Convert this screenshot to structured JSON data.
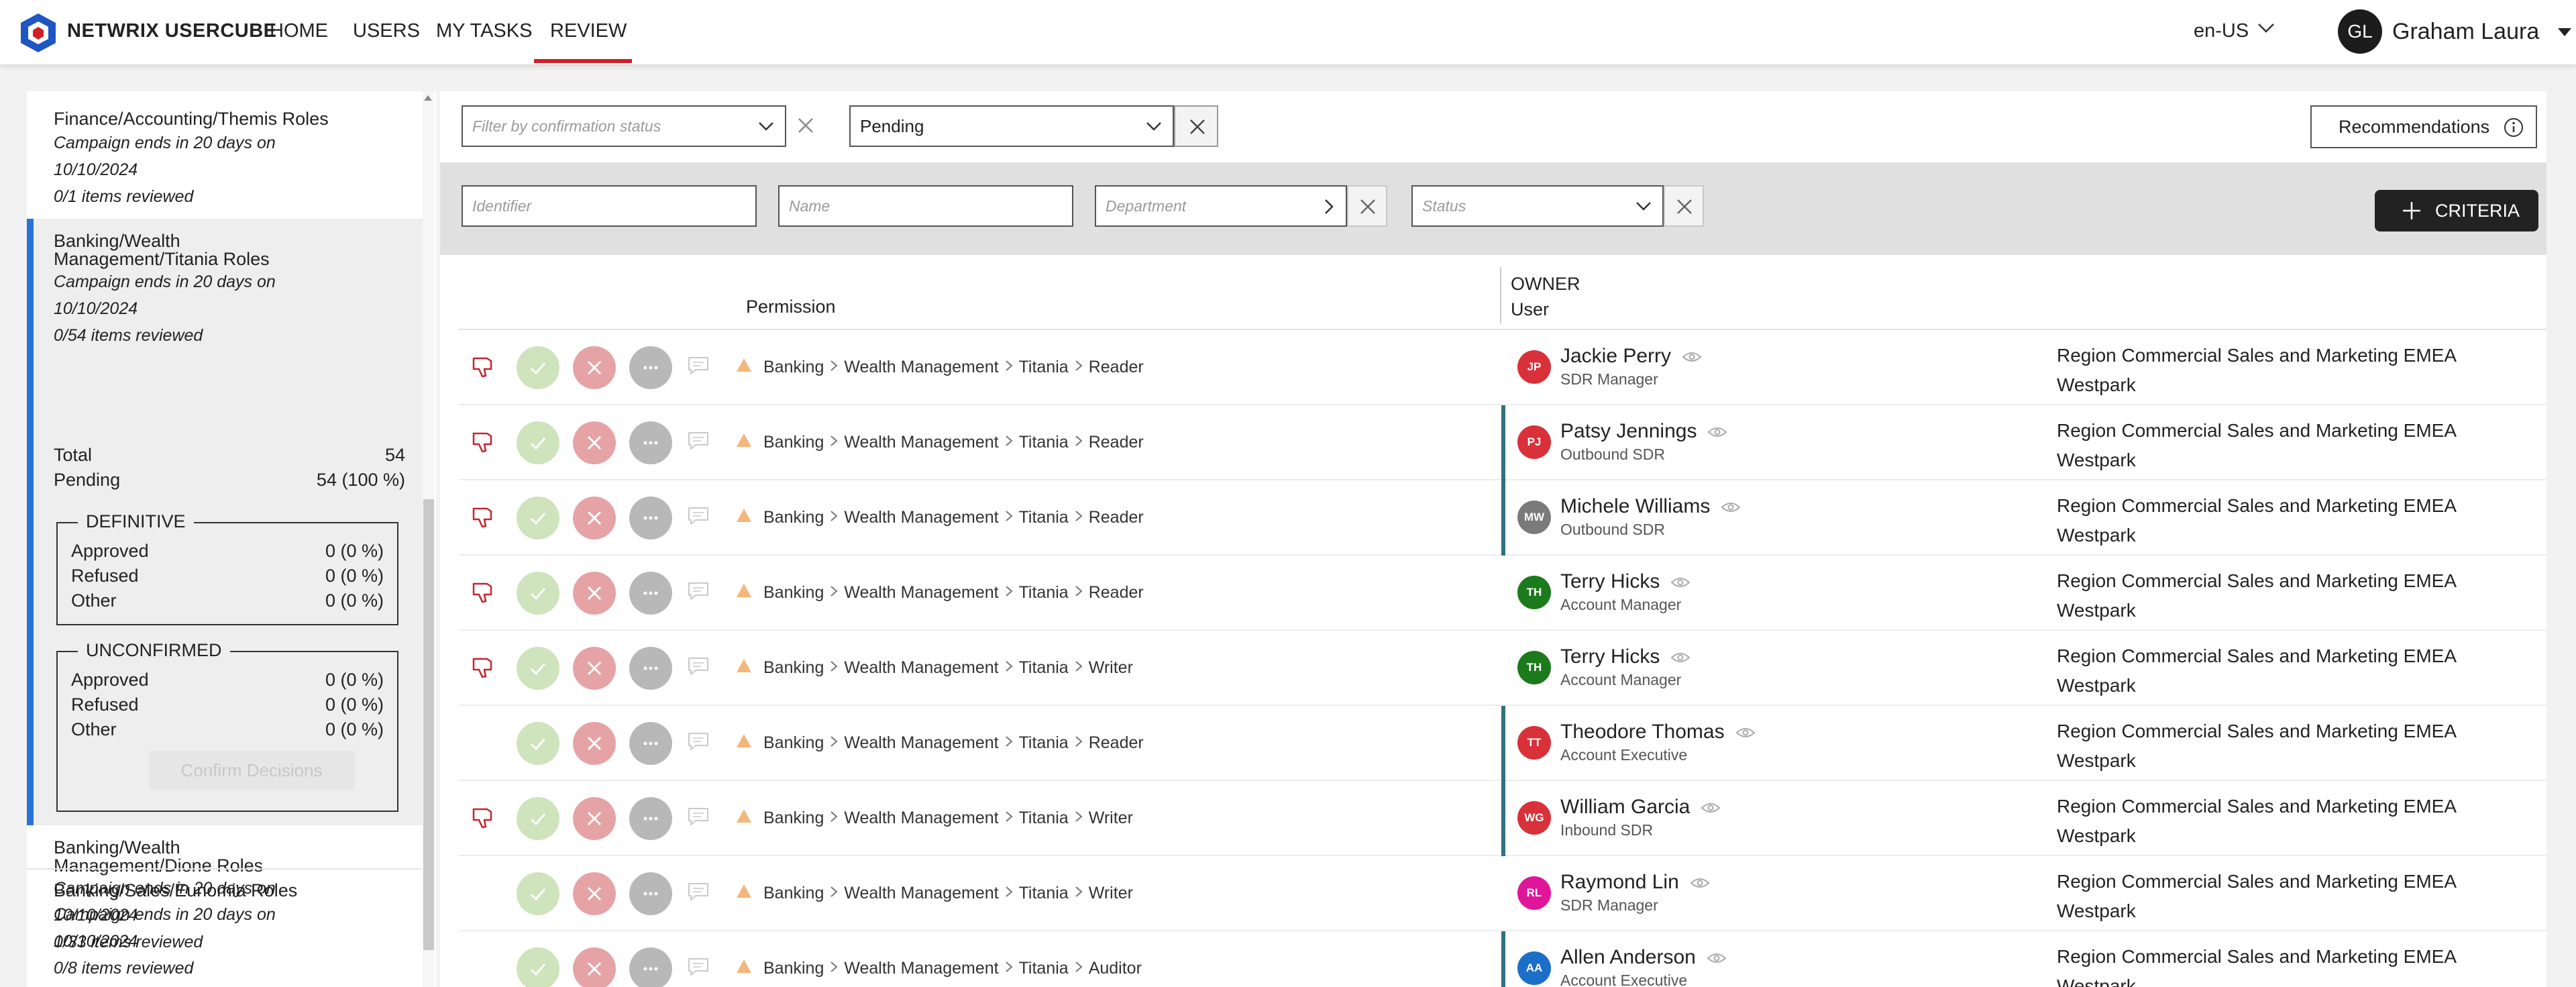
{
  "app": {
    "brand": "NETWRIX USERCUBE",
    "nav": [
      "HOME",
      "USERS",
      "MY TASKS",
      "REVIEW"
    ],
    "active_nav": "REVIEW",
    "language": "en-US",
    "user_initials": "GL",
    "user_name": "Graham Laura",
    "accent_color": "#d21f26"
  },
  "sidebar": {
    "campaigns": [
      {
        "title": "Finance/Accounting/Themis Roles",
        "ends": "Campaign ends in 20 days on",
        "date": "10/10/2024",
        "reviewed": "0/1 items reviewed"
      },
      {
        "title": "Banking/Wealth Management/Titania Roles",
        "title_l1": "Banking/Wealth",
        "title_l2": "Management/Titania Roles",
        "ends": "Campaign ends in 20 days on",
        "date": "10/10/2024",
        "reviewed": "0/54 items reviewed"
      },
      {
        "title": "Banking/Wealth Management/Dione Roles",
        "title_l1": "Banking/Wealth",
        "title_l2": "Management/Dione Roles",
        "ends": "Campaign ends in 20 days on",
        "date": "10/10/2024",
        "reviewed": "0/33 items reviewed"
      },
      {
        "title": "Banking/Sales/Eunomia Roles",
        "ends": "Campaign ends in 20 days on",
        "date": "10/10/2024",
        "reviewed": "0/8 items reviewed"
      }
    ],
    "stats": {
      "total_label": "Total",
      "total_value": "54",
      "pending_label": "Pending",
      "pending_value": "54 (100 %)",
      "definitive": {
        "legend": "DEFINITIVE",
        "approved_label": "Approved",
        "approved": "0 (0 %)",
        "refused_label": "Refused",
        "refused": "0 (0 %)",
        "other_label": "Other",
        "other": "0 (0 %)"
      },
      "unconfirmed": {
        "legend": "UNCONFIRMED",
        "approved_label": "Approved",
        "approved": "0 (0 %)",
        "refused_label": "Refused",
        "refused": "0 (0 %)",
        "other_label": "Other",
        "other": "0 (0 %)"
      },
      "confirm_label": "Confirm Decisions"
    }
  },
  "filters": {
    "confirmation_placeholder": "Filter by confirmation status",
    "pending_value": "Pending",
    "recommendations_label": "Recommendations",
    "identifier_placeholder": "Identifier",
    "name_placeholder": "Name",
    "department_placeholder": "Department",
    "status_placeholder": "Status",
    "criteria_label": "CRITERIA"
  },
  "table": {
    "owner_header": "OWNER",
    "user_header": "User",
    "permission_header": "Permission",
    "rows": [
      {
        "thumb": true,
        "path": [
          "Banking",
          "Wealth Management",
          "Titania",
          "Reader"
        ],
        "bar": false,
        "initials": "JP",
        "avatar_color": "#d8313a",
        "name": "Jackie Perry",
        "title": "SDR Manager",
        "dept1": "Region Commercial Sales and Marketing EMEA",
        "dept2": "Westpark"
      },
      {
        "thumb": true,
        "path": [
          "Banking",
          "Wealth Management",
          "Titania",
          "Reader"
        ],
        "bar": true,
        "initials": "PJ",
        "avatar_color": "#d8313a",
        "name": "Patsy Jennings",
        "title": "Outbound SDR",
        "dept1": "Region Commercial Sales and Marketing EMEA",
        "dept2": "Westpark"
      },
      {
        "thumb": true,
        "path": [
          "Banking",
          "Wealth Management",
          "Titania",
          "Reader"
        ],
        "bar": true,
        "initials": "MW",
        "avatar_color": "#7a7a7a",
        "name": "Michele Williams",
        "title": "Outbound SDR",
        "dept1": "Region Commercial Sales and Marketing EMEA",
        "dept2": "Westpark"
      },
      {
        "thumb": true,
        "path": [
          "Banking",
          "Wealth Management",
          "Titania",
          "Reader"
        ],
        "bar": false,
        "initials": "TH",
        "avatar_color": "#1b7a1b",
        "name": "Terry Hicks",
        "title": "Account Manager",
        "dept1": "Region Commercial Sales and Marketing EMEA",
        "dept2": "Westpark"
      },
      {
        "thumb": true,
        "path": [
          "Banking",
          "Wealth Management",
          "Titania",
          "Writer"
        ],
        "bar": false,
        "initials": "TH",
        "avatar_color": "#1b7a1b",
        "name": "Terry Hicks",
        "title": "Account Manager",
        "dept1": "Region Commercial Sales and Marketing EMEA",
        "dept2": "Westpark"
      },
      {
        "thumb": false,
        "path": [
          "Banking",
          "Wealth Management",
          "Titania",
          "Reader"
        ],
        "bar": true,
        "initials": "TT",
        "avatar_color": "#d8313a",
        "name": "Theodore Thomas",
        "title": "Account Executive",
        "dept1": "Region Commercial Sales and Marketing EMEA",
        "dept2": "Westpark"
      },
      {
        "thumb": true,
        "path": [
          "Banking",
          "Wealth Management",
          "Titania",
          "Writer"
        ],
        "bar": true,
        "initials": "WG",
        "avatar_color": "#d8313a",
        "name": "William Garcia",
        "title": "Inbound SDR",
        "dept1": "Region Commercial Sales and Marketing EMEA",
        "dept2": "Westpark"
      },
      {
        "thumb": false,
        "path": [
          "Banking",
          "Wealth Management",
          "Titania",
          "Writer"
        ],
        "bar": false,
        "initials": "RL",
        "avatar_color": "#e0169a",
        "name": "Raymond Lin",
        "title": "SDR Manager",
        "dept1": "Region Commercial Sales and Marketing EMEA",
        "dept2": "Westpark"
      },
      {
        "thumb": false,
        "path": [
          "Banking",
          "Wealth Management",
          "Titania",
          "Auditor"
        ],
        "bar": true,
        "initials": "AA",
        "avatar_color": "#1c6fc7",
        "name": "Allen Anderson",
        "title": "Account Executive",
        "dept1": "Region Commercial Sales and Marketing EMEA",
        "dept2": "Westpark"
      }
    ]
  }
}
